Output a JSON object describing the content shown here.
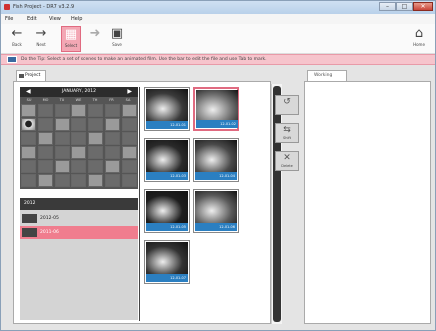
{
  "window": {
    "title": "Fish Project - DR7 v3.2.9",
    "controls": {
      "minimize": "–",
      "maximize": "□",
      "close": "✕"
    }
  },
  "menu": {
    "items": [
      "File",
      "Edit",
      "View",
      "Help"
    ]
  },
  "toolbar": {
    "back": {
      "label": "Back",
      "icon": "arrow-left-icon"
    },
    "next": {
      "label": "Next",
      "icon": "arrow-right-icon"
    },
    "select": {
      "label": "Select",
      "icon": "grid-icon"
    },
    "import": {
      "label": "",
      "icon": "import-icon"
    },
    "save": {
      "label": "Save",
      "icon": "disk-icon"
    },
    "home": {
      "label": "Home",
      "icon": "house-icon"
    }
  },
  "tip": {
    "text": "Do the Tip: Select a set of scenes to make an animated film. Use the bar to edit the file and use Tab to mark."
  },
  "left_tab": {
    "label": "Project"
  },
  "calendar": {
    "month": "JANUARY, 2012",
    "weekdays": [
      "SU",
      "MO",
      "TU",
      "WE",
      "TH",
      "FR",
      "SA"
    ],
    "rows": [
      [
        "",
        "",
        "",
        "",
        "",
        "",
        ""
      ],
      [
        "",
        "",
        "",
        "",
        "",
        "",
        ""
      ],
      [
        "",
        "",
        "",
        "",
        "",
        "",
        ""
      ],
      [
        "",
        "",
        "",
        "",
        "",
        "",
        ""
      ],
      [
        "",
        "",
        "",
        "",
        "",
        "",
        ""
      ],
      [
        "",
        "",
        "",
        "",
        "",
        "",
        ""
      ]
    ]
  },
  "album": {
    "header": "2012",
    "rows": [
      {
        "label": "2012-05",
        "selected": false
      },
      {
        "label": "2011-06",
        "selected": true
      }
    ]
  },
  "thumbnails": [
    {
      "caption": "12-01-01",
      "selected": false
    },
    {
      "caption": "12-01-02",
      "selected": true
    },
    {
      "caption": "12-01-03",
      "selected": false
    },
    {
      "caption": "12-01-04",
      "selected": false
    },
    {
      "caption": "12-01-05",
      "selected": false
    },
    {
      "caption": "12-01-06",
      "selected": false
    },
    {
      "caption": "12-01-07",
      "selected": false
    }
  ],
  "side_buttons": [
    {
      "label": "",
      "icon": "rotate-left-icon"
    },
    {
      "label": "Shift",
      "icon": "move-icon"
    },
    {
      "label": "Delete",
      "icon": "delete-icon"
    }
  ],
  "right_tab": {
    "label": "Working"
  }
}
